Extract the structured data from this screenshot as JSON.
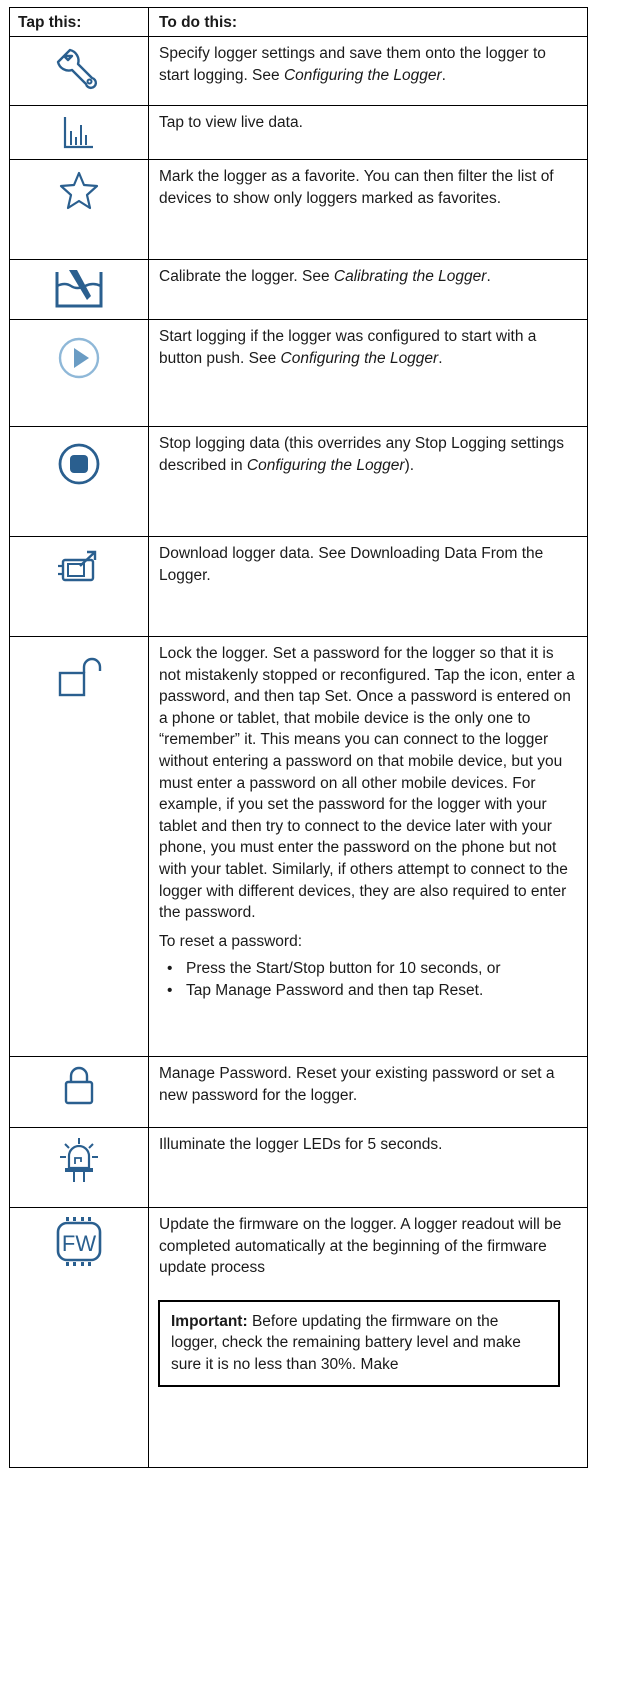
{
  "header": {
    "col1": "Tap this:",
    "col2": "To do this:"
  },
  "accent_color": "#2a5f8f",
  "rows": [
    {
      "icon": "wrench-icon",
      "segments": [
        "Specify logger settings and save them onto the logger to start logging. See ",
        "Configuring the Logger",
        "."
      ]
    },
    {
      "icon": "live-data-chart-icon",
      "text": "Tap to view live data."
    },
    {
      "icon": "star-icon",
      "text": "Mark the logger as a favorite. You can then filter the list of devices to show only loggers marked as favorites."
    },
    {
      "icon": "calibrate-icon",
      "segments": [
        "Calibrate the logger. See ",
        "Calibrating the Logger",
        "."
      ]
    },
    {
      "icon": "play-icon",
      "segments": [
        "Start logging if the logger was configured to start with a button push. See ",
        "Configuring the Logger",
        "."
      ]
    },
    {
      "icon": "stop-icon",
      "segments": [
        "Stop logging data (this overrides any Stop Logging settings described in ",
        "Configuring the Logger",
        ")."
      ]
    },
    {
      "icon": "download-icon",
      "text": "Download logger data. See Downloading Data From the Logger."
    },
    {
      "icon": "unlock-icon",
      "text": "Lock the logger. Set a password for the logger so that it is not mistakenly stopped or reconfigured. Tap the icon, enter a password, and then tap Set. Once a password is entered on a phone or tablet, that mobile device is the only one to “remember” it. This means you can connect to the logger without entering a password on that mobile device, but you must enter a password on all other mobile devices. For example, if you set the password for the logger with your tablet and then try to connect to the device later with your phone, you must enter the password on the phone but not with your tablet. Similarly, if others attempt to connect to the logger with different devices, they are also required to enter the password.",
      "reset_heading": "To reset a password:",
      "bullets": [
        "Press the Start/Stop button for 10 seconds, or",
        "Tap Manage Password and then tap Reset."
      ]
    },
    {
      "icon": "lock-icon",
      "text": "Manage Password. Reset your existing password or set a new password for the logger."
    },
    {
      "icon": "led-icon",
      "text": "Illuminate the logger LEDs for 5 seconds."
    },
    {
      "icon": "firmware-icon",
      "icon_label": "FW",
      "text": "Update the firmware on the logger. A logger readout will be completed automatically at the beginning of the firmware update process",
      "note_label": "Important:",
      "note_text": " Before updating the firmware on the logger, check the remaining battery level and make sure it is no less than 30%. Make"
    }
  ]
}
